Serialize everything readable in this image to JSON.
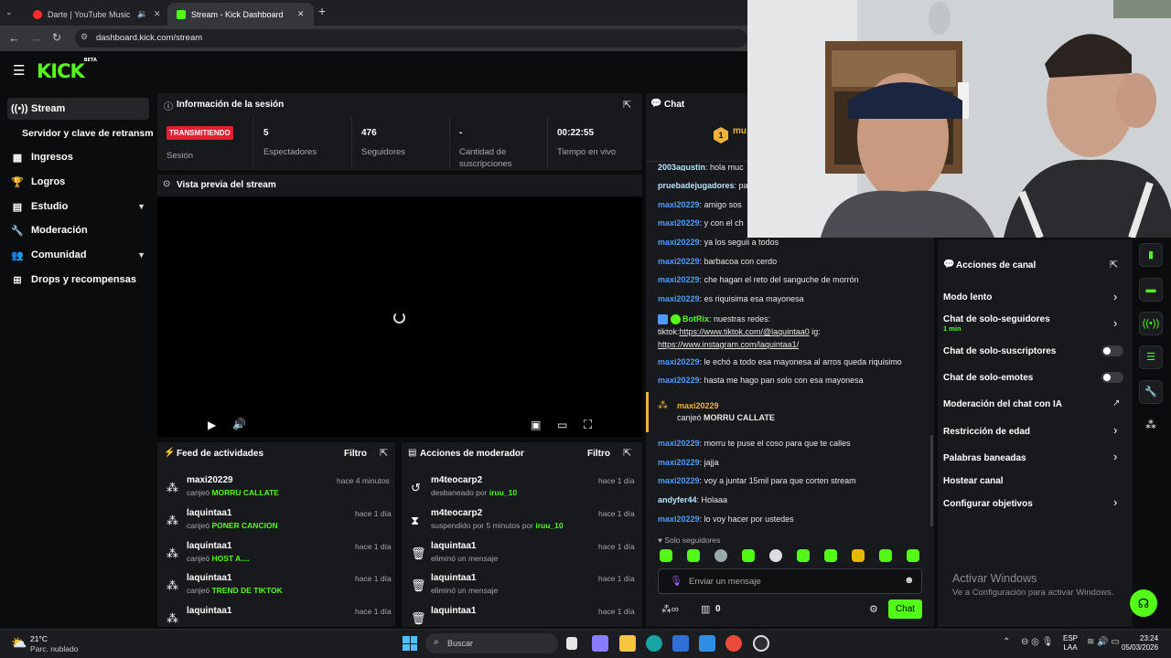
{
  "browser": {
    "tabs": [
      {
        "label": "Darte | YouTube Music"
      },
      {
        "label": "Stream - Kick Dashboard"
      }
    ],
    "url": "dashboard.kick.com/stream"
  },
  "brand": {
    "logo": "KICK",
    "beta": "BETA",
    "accent": "#53fc18"
  },
  "sidebar": {
    "items": [
      {
        "label": "Stream",
        "icon": "broadcast-icon"
      },
      {
        "label": "Servidor y clave de retransm"
      },
      {
        "label": "Ingresos",
        "icon": "chart-icon"
      },
      {
        "label": "Logros",
        "icon": "trophy-icon"
      },
      {
        "label": "Estudio",
        "icon": "studio-icon"
      },
      {
        "label": "Moderación",
        "icon": "wrench-icon"
      },
      {
        "label": "Comunidad",
        "icon": "community-icon"
      },
      {
        "label": "Drops y recompensas",
        "icon": "gift-icon"
      }
    ]
  },
  "session": {
    "title": "Información de la sesión",
    "status_badge": "TRANSMITIENDO",
    "status_label": "Sesión",
    "stats": [
      {
        "value": "5",
        "label": "Espectadores"
      },
      {
        "value": "476",
        "label": "Seguidores"
      },
      {
        "value": "-",
        "label": "Cantidad de suscripciones"
      },
      {
        "value": "00:22:55",
        "label": "Tiempo en vivo"
      }
    ]
  },
  "preview": {
    "title": "Vista previa del stream"
  },
  "activity": {
    "title": "Feed de actividades",
    "filter": "Filtro",
    "items": [
      {
        "name": "maxi20229",
        "action": "canjeó",
        "reward": "MORRU CALLATE",
        "time": "hace 4 minutos"
      },
      {
        "name": "laquintaa1",
        "action": "canjeó",
        "reward": "PONER CANCION",
        "time": "hace 1 día"
      },
      {
        "name": "laquintaa1",
        "action": "canjeó",
        "reward": "HOST A....",
        "time": "hace 1 día"
      },
      {
        "name": "laquintaa1",
        "action": "canjeó",
        "reward": "TREND DE TIKTOK",
        "time": "hace 1 día"
      },
      {
        "name": "laquintaa1",
        "action": "",
        "reward": "",
        "time": "hace 1 día"
      }
    ]
  },
  "modactions": {
    "title": "Acciones de moderador",
    "filter": "Filtro",
    "items": [
      {
        "name": "m4teocarp2",
        "action": "desbaneado por",
        "by": "iruu_10",
        "time": "hace 1 día"
      },
      {
        "name": "m4teocarp2",
        "action": "suspendido por 5 minutos por",
        "by": "iruu_10",
        "time": "hace 1 día"
      },
      {
        "name": "laquintaa1",
        "action": "eliminó un mensaje",
        "by": "",
        "time": "hace 1 día"
      },
      {
        "name": "laquintaa1",
        "action": "eliminó un mensaje",
        "by": "",
        "time": "hace 1 día"
      },
      {
        "name": "laquintaa1",
        "action": "",
        "by": "",
        "time": "hace 1 día"
      }
    ]
  },
  "chat": {
    "title": "Chat",
    "pinned_user": "mu",
    "pinned_rank": "1",
    "messages": [
      {
        "user": "maxi20229",
        "text": "amigo sos"
      },
      {
        "user": "maxi20229",
        "text": "y con el ch"
      },
      {
        "user": "maxi20229",
        "text": "ya los seguii a todos"
      },
      {
        "user": "maxi20229",
        "text": "barbacoa con cerdo"
      },
      {
        "user": "maxi20229",
        "text": "che hagan el reto del sanguche de morrón"
      },
      {
        "user": "maxi20229",
        "text": "es riquisima esa mayonesa"
      },
      {
        "user": "maxi20229",
        "text": "le echó a todo esa mayonesa al arros queda riquisimo"
      },
      {
        "user": "maxi20229",
        "text": "hasta me hago pan solo con esa mayonesa"
      },
      {
        "user": "maxi20229",
        "text": "morru te puse el coso para que te calles"
      },
      {
        "user": "maxi20229",
        "text": "jajja"
      },
      {
        "user": "maxi20229",
        "text": "voy a juntar 15mil para que corten stream"
      },
      {
        "user": "andyfer44",
        "text": "Holaaa"
      },
      {
        "user": "maxi20229",
        "text": "lo voy hacer por ustedes"
      }
    ],
    "partial_top": [
      {
        "user": "2003agustin",
        "text": "hola muc"
      },
      {
        "user": "pruebadejugadores",
        "text": "pa"
      }
    ],
    "bot_message": {
      "user": "BotRix",
      "text1": "nuestras redes:",
      "text2": "tiktok:",
      "link1": "https://www.tiktok.com/@laquintaa0",
      "text3": "ig:",
      "link2": "https://www.instagram.com/laquintaa1/"
    },
    "redeem": {
      "user": "maxi20229",
      "action": "canjeó",
      "reward": "MORRU CALLATE"
    },
    "mode": "Solo seguidores",
    "input_placeholder": "Enviar un mensaje",
    "bottom_count": "0",
    "send_label": "Chat"
  },
  "channel_actions": {
    "title": "Acciones de canal",
    "items": [
      {
        "label": "Modo lento",
        "kind": "arrow"
      },
      {
        "label": "Chat de solo-seguidores",
        "sub": "1 min",
        "kind": "arrow"
      },
      {
        "label": "Chat de solo-suscriptores",
        "kind": "toggle",
        "on": false
      },
      {
        "label": "Chat de solo-emotes",
        "kind": "toggle",
        "on": false
      },
      {
        "label": "Moderación del chat con IA",
        "kind": "external"
      },
      {
        "label": "Restricción de edad",
        "kind": "arrow"
      },
      {
        "label": "Palabras baneadas",
        "kind": "arrow"
      },
      {
        "label": "Hostear canal",
        "kind": "none"
      },
      {
        "label": "Configurar objetivos",
        "kind": "arrow"
      }
    ]
  },
  "watermark": {
    "line1": "Activar Windows",
    "line2": "Ve a Configuración para activar Windows."
  },
  "taskbar": {
    "weather_temp": "21°C",
    "weather_desc": "Parc. nublado",
    "search": "Buscar",
    "lang1": "ESP",
    "lang2": "LAA",
    "time": "23:24",
    "date": "05/03/2026"
  }
}
